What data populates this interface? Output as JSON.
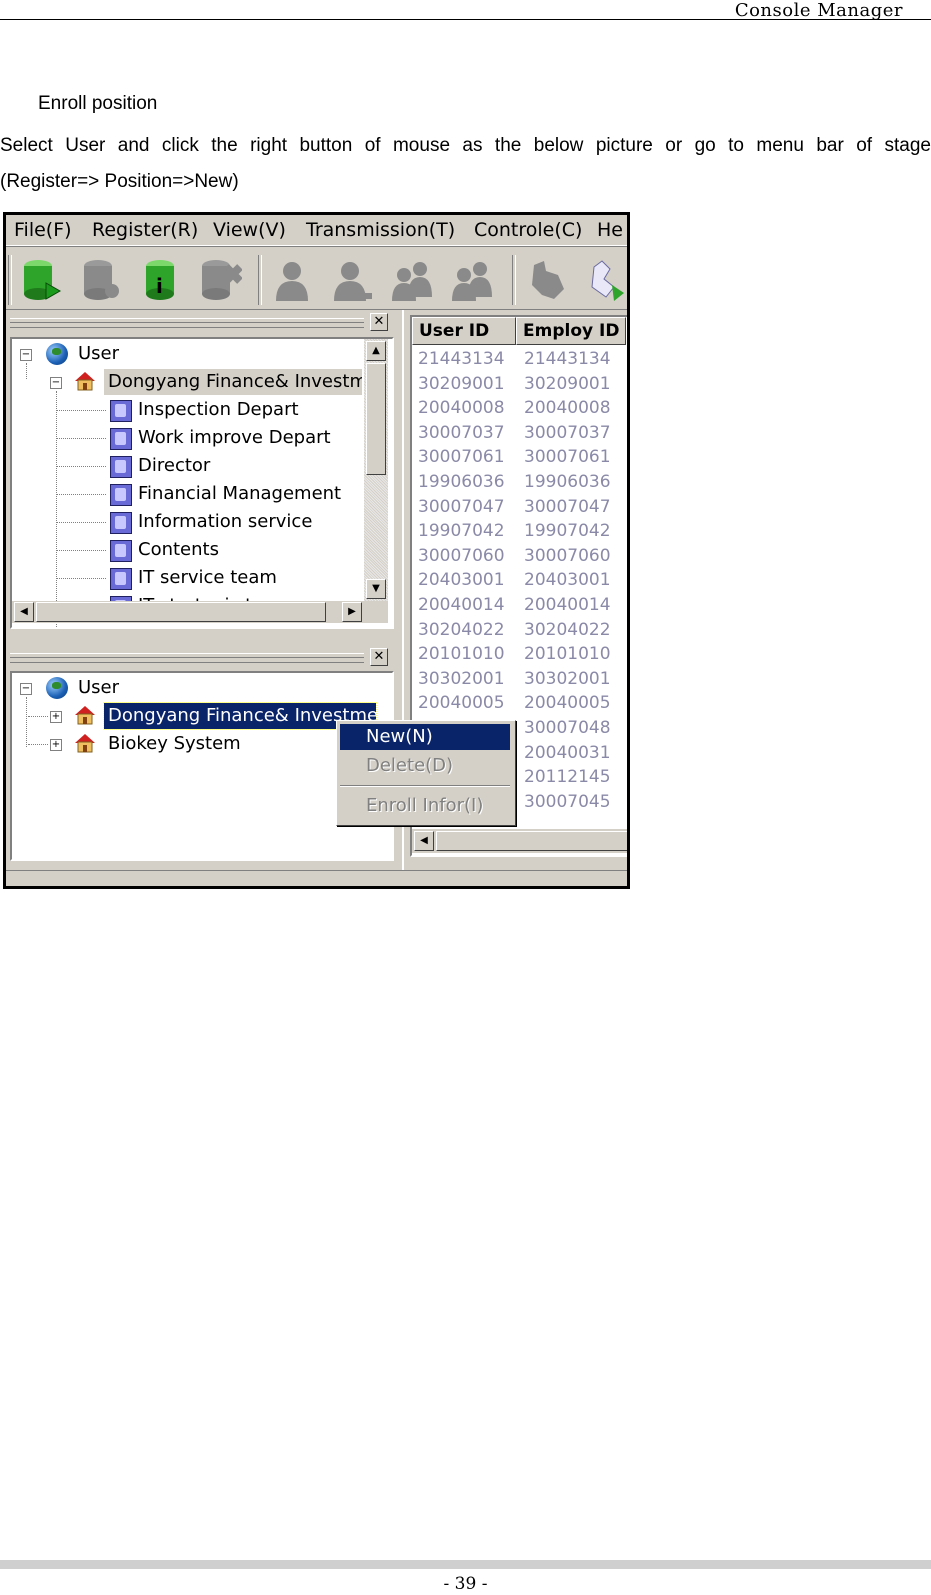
{
  "header": {
    "title": "Console Manager"
  },
  "section": {
    "title": "Enroll position",
    "paragraph_line1": "Select User and click the right button of mouse as the below picture or go to menu bar of stage",
    "paragraph_line2": "(Register=> Position=>New)"
  },
  "screenshot": {
    "menu": [
      "File(F)",
      "Register(R)",
      "View(V)",
      "Transmission(T)",
      "Controle(C)",
      "He"
    ],
    "toolbar_icons": [
      "user-db-add-icon",
      "user-db-icon",
      "user-db-info-icon",
      "user-db-delete-icon",
      "person-icon",
      "person-edit-icon",
      "group-icon",
      "group-edit-icon",
      "transfer-icon",
      "hand-download-icon"
    ],
    "top_tree": {
      "root": "User",
      "company": "Dongyang Finance& Investmen",
      "departments": [
        "Inspection Depart",
        "Work improve Depart",
        "Director",
        "Financial Management",
        "Information service",
        "Contents",
        "IT service team",
        "IT strategic team"
      ]
    },
    "bottom_tree": {
      "root": "User",
      "items": [
        "Dongyang Finance& Investment",
        "Biokey System"
      ]
    },
    "table": {
      "columns": [
        "User ID",
        "Employ ID"
      ],
      "rows": [
        [
          "21443134",
          "21443134"
        ],
        [
          "30209001",
          "30209001"
        ],
        [
          "20040008",
          "20040008"
        ],
        [
          "30007037",
          "30007037"
        ],
        [
          "30007061",
          "30007061"
        ],
        [
          "19906036",
          "19906036"
        ],
        [
          "30007047",
          "30007047"
        ],
        [
          "19907042",
          "19907042"
        ],
        [
          "30007060",
          "30007060"
        ],
        [
          "20403001",
          "20403001"
        ],
        [
          "20040014",
          "20040014"
        ],
        [
          "30204022",
          "30204022"
        ],
        [
          "20101010",
          "20101010"
        ],
        [
          "30302001",
          "30302001"
        ],
        [
          "20040005",
          "20040005"
        ],
        [
          "",
          "30007048"
        ],
        [
          "",
          "20040031"
        ],
        [
          "",
          "20112145"
        ],
        [
          "",
          "30007045"
        ]
      ]
    },
    "context_menu": {
      "new": "New(N)",
      "delete": "Delete(D)",
      "enroll_info": "Enroll Infor(I)"
    }
  },
  "footer": {
    "page": "- 39 -"
  }
}
